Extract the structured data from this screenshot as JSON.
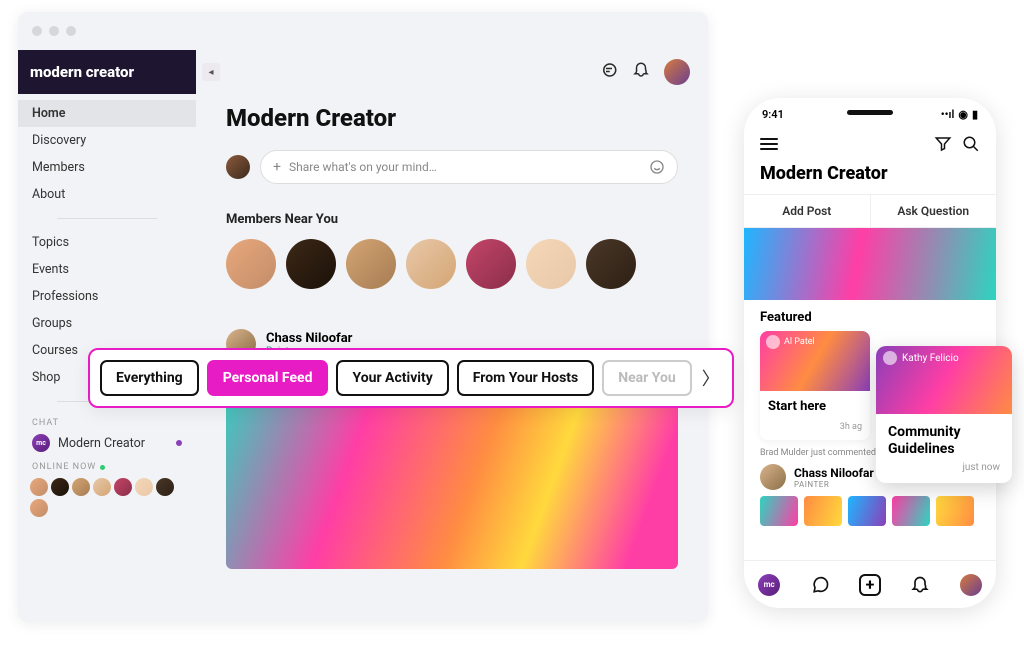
{
  "brand": "modern creator",
  "sidebar": {
    "nav": [
      "Home",
      "Discovery",
      "Members",
      "About"
    ],
    "sections": [
      "Topics",
      "Events",
      "Professions",
      "Groups",
      "Courses",
      "Shop"
    ],
    "chat_label": "CHAT",
    "chat_item": "Modern Creator",
    "online_label": "ONLINE NOW"
  },
  "main": {
    "title": "Modern Creator",
    "composer_placeholder": "Share what's on your mind…",
    "members_near_title": "Members Near You",
    "post": {
      "author": "Chass Niloofar",
      "role": "Painter"
    }
  },
  "feed_tabs": [
    "Everything",
    "Personal Feed",
    "Your Activity",
    "From Your Hosts",
    "Near You"
  ],
  "feed_tabs_active_index": 1,
  "mobile": {
    "time": "9:41",
    "title": "Modern Creator",
    "add_post": "Add Post",
    "ask_question": "Ask Question",
    "featured_label": "Featured",
    "card1_user": "Al Patel",
    "card1_title": "Start here",
    "card1_time": "3h ag",
    "comment_line": "Brad Mulder just commented on this.",
    "post_author": "Chass Niloofar",
    "post_role": "PAINTER"
  },
  "float_card": {
    "user": "Kathy Felicio",
    "title": "Community Guidelines",
    "time": "just now"
  },
  "colors": {
    "accent": "#e81cc4",
    "brand_bg": "#1e1530"
  }
}
